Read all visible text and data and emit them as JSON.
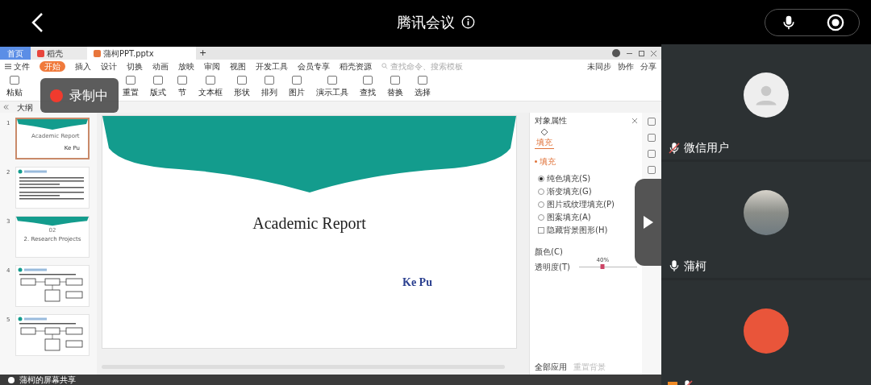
{
  "meeting": {
    "title": "腾讯会议"
  },
  "recording": {
    "label": "录制中"
  },
  "wps": {
    "tabs": [
      {
        "label": "首页",
        "kind": "home",
        "selected": false
      },
      {
        "label": "稻壳",
        "kind": "doc",
        "selected": false
      },
      {
        "label": "蒲柯PPT.pptx",
        "kind": "ppt",
        "selected": true
      }
    ],
    "tab_add": "+",
    "menu": [
      {
        "label": "文件",
        "selected": false
      },
      {
        "label": "开始",
        "selected": true
      },
      {
        "label": "插入",
        "selected": false
      },
      {
        "label": "设计",
        "selected": false
      },
      {
        "label": "切换",
        "selected": false
      },
      {
        "label": "动画",
        "selected": false
      },
      {
        "label": "放映",
        "selected": false
      },
      {
        "label": "审阅",
        "selected": false
      },
      {
        "label": "视图",
        "selected": false
      },
      {
        "label": "开发工具",
        "selected": false
      },
      {
        "label": "会员专享",
        "selected": false
      },
      {
        "label": "稻壳资源",
        "selected": false
      }
    ],
    "search_placeholder": "查找命令、搜索模板",
    "actions": [
      "未同步",
      "协作",
      "分享"
    ],
    "ribbon": [
      "粘贴",
      "重置",
      "版式",
      "节",
      "文本框",
      "形状",
      "排列",
      "图片",
      "演示工具",
      "查找",
      "替换",
      "选择"
    ],
    "outline_tab": "大纲",
    "thumbnails": [
      {
        "number": "1",
        "kind": "title",
        "selected": true,
        "title": "Academic Report",
        "author": "Ke Pu"
      },
      {
        "number": "2",
        "kind": "text",
        "selected": false
      },
      {
        "number": "3",
        "kind": "section",
        "selected": false,
        "badge": "02",
        "title": "2. Research Projects"
      },
      {
        "number": "4",
        "kind": "diagram",
        "selected": false
      },
      {
        "number": "5",
        "kind": "diagram",
        "selected": false
      }
    ],
    "slide": {
      "title": "Academic Report",
      "author": "Ke Pu"
    },
    "panel": {
      "title": "对象属性",
      "tabs": [
        {
          "label": "填充",
          "selected": true
        }
      ],
      "section": "填充",
      "options": [
        {
          "label": "纯色填充(S)",
          "kind": "radio",
          "checked": true
        },
        {
          "label": "渐变填充(G)",
          "kind": "radio",
          "checked": false
        },
        {
          "label": "图片或纹理填充(P)",
          "kind": "radio",
          "checked": false
        },
        {
          "label": "图案填充(A)",
          "kind": "radio",
          "checked": false
        },
        {
          "label": "隐藏背景图形(H)",
          "kind": "checkbox",
          "checked": false
        }
      ],
      "color_label": "颜色(C)",
      "transparency_label": "透明度(T)",
      "transparency": {
        "level": 0.4,
        "reading": "40%"
      },
      "footer": [
        "全部应用",
        "重置背景"
      ]
    }
  },
  "participants": [
    {
      "name": "微信用户",
      "muted": true,
      "kind": "default"
    },
    {
      "name": "蒲柯",
      "muted": false,
      "kind": "photo"
    },
    {
      "muted": true,
      "kind": "illustration"
    }
  ],
  "share_label": "蒲柯的屏幕共享"
}
